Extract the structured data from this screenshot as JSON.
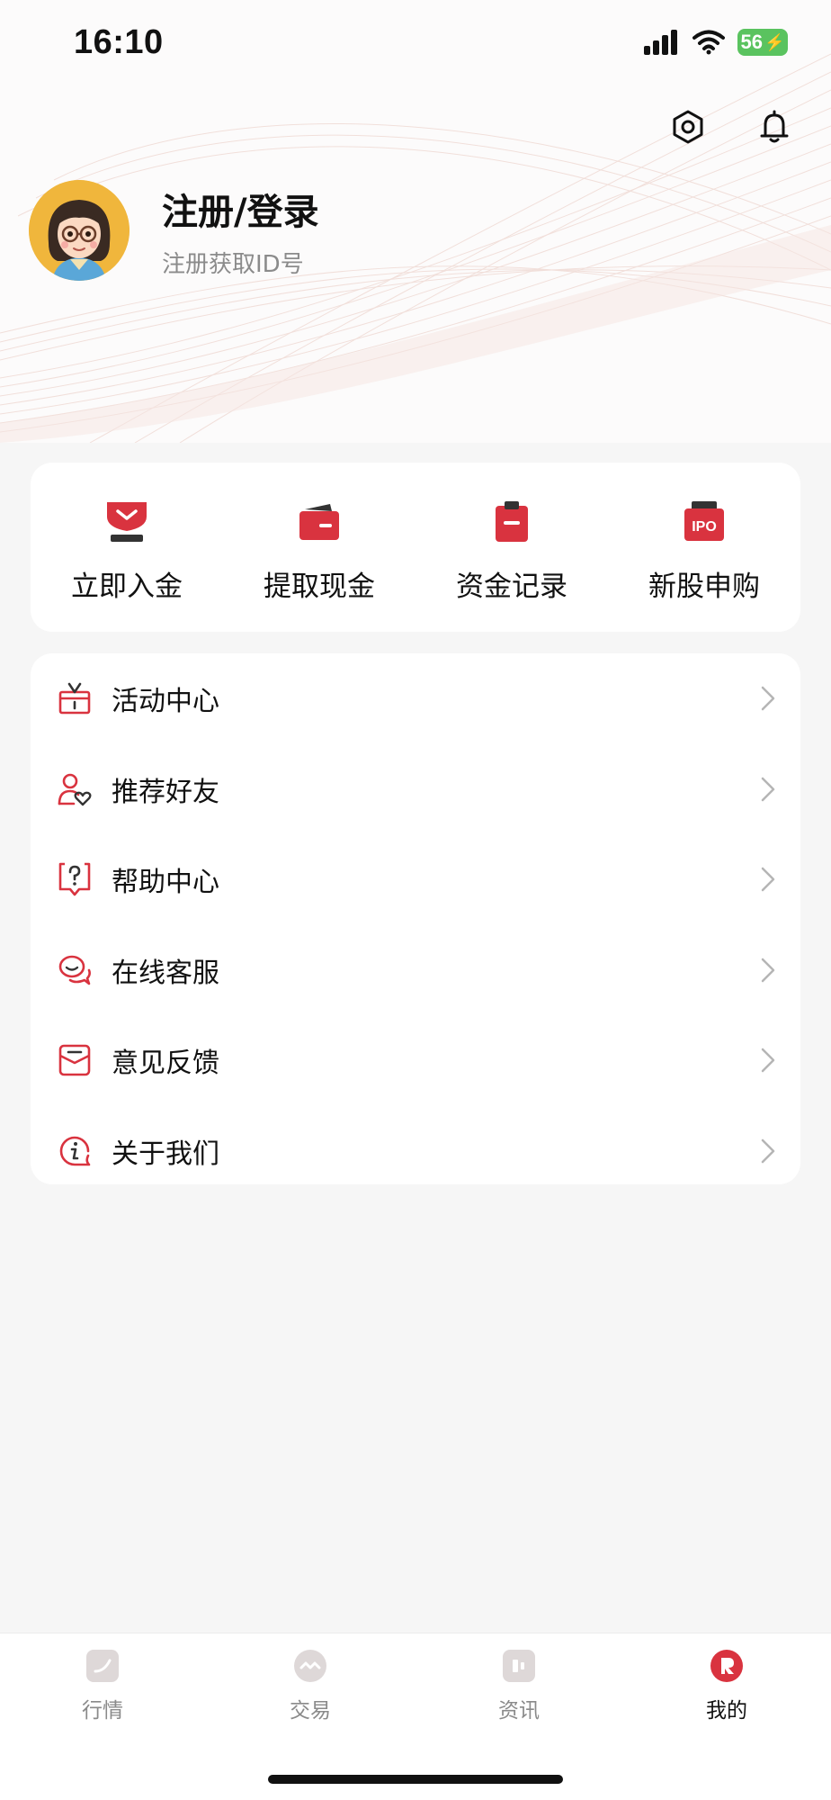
{
  "status_bar": {
    "time": "16:10",
    "battery": "56"
  },
  "profile": {
    "title": "注册/登录",
    "subtitle": "注册获取ID号"
  },
  "quick_actions": [
    {
      "label": "立即入金",
      "icon": "deposit-icon"
    },
    {
      "label": "提取现金",
      "icon": "wallet-icon"
    },
    {
      "label": "资金记录",
      "icon": "clipboard-icon"
    },
    {
      "label": "新股申购",
      "icon": "ipo-icon",
      "badge": "IPO"
    }
  ],
  "menu": [
    {
      "label": "活动中心",
      "icon": "gift-icon"
    },
    {
      "label": "推荐好友",
      "icon": "user-heart-icon"
    },
    {
      "label": "帮助中心",
      "icon": "help-icon"
    },
    {
      "label": "在线客服",
      "icon": "chat-icon"
    },
    {
      "label": "意见反馈",
      "icon": "feedback-icon"
    },
    {
      "label": "关于我们",
      "icon": "info-icon"
    }
  ],
  "tabs": [
    {
      "label": "行情",
      "icon": "market-icon",
      "active": false
    },
    {
      "label": "交易",
      "icon": "trade-icon",
      "active": false
    },
    {
      "label": "资讯",
      "icon": "news-icon",
      "active": false
    },
    {
      "label": "我的",
      "icon": "profile-icon",
      "active": true
    }
  ],
  "colors": {
    "accent": "#d9333f",
    "inactive": "#8a8a8a",
    "background": "#f6f6f6"
  }
}
